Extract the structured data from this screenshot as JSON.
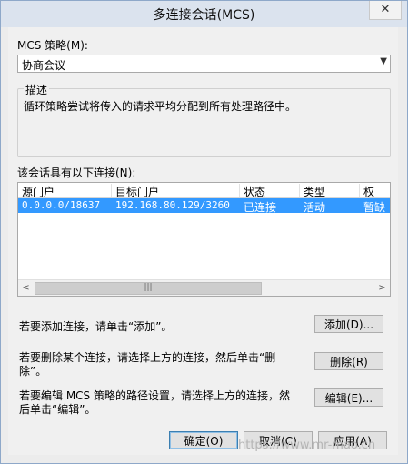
{
  "window": {
    "title": "多连接会话(MCS)",
    "close_label": "✕"
  },
  "policy": {
    "label": "MCS 策略(M):",
    "selected": "协商会议"
  },
  "description": {
    "legend": "描述",
    "text": "循环策略尝试将传入的请求平均分配到所有处理路径中。"
  },
  "connections": {
    "label": "该会话具有以下连接(N):",
    "columns": [
      "源门户",
      "目标门户",
      "状态",
      "类型",
      "权"
    ],
    "rows": [
      {
        "source": "0.0.0.0/18637",
        "target": "192.168.80.129/3260",
        "status": "已连接",
        "type": "活动",
        "weight": "暂缺"
      }
    ]
  },
  "scrollbar": {
    "left_arrow": "<",
    "right_arrow": ">",
    "thumb_grip": "|||"
  },
  "instructions": {
    "add": "若要添加连接，请单击“添加”。",
    "remove_line1": "若要删除某个连接，请选择上方的连接，然后单击“删",
    "remove_line2": "除”。",
    "edit_line1": "若要编辑 MCS 策略的路径设置，请选择上方的连接，然",
    "edit_line2": "后单击“编辑”。"
  },
  "buttons": {
    "add": "添加(D)...",
    "remove": "删除(R)",
    "edit": "编辑(E)...",
    "ok": "确定(O)",
    "cancel": "取消(C)",
    "apply": "应用(A)"
  },
  "watermark": "https://www.mr-mao.cn",
  "colors": {
    "selection": "#3399ff",
    "titlebar": "#dbe3ee"
  }
}
